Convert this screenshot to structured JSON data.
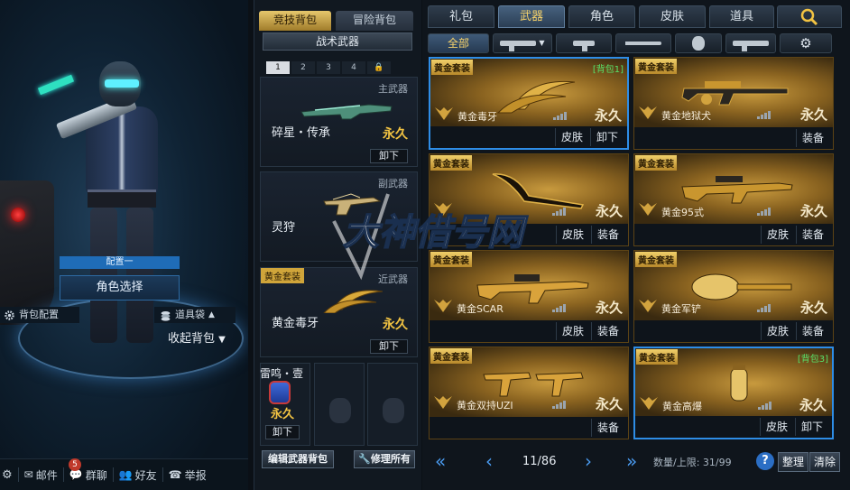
{
  "left": {
    "config_label": "配置一",
    "role_select": "角色选择",
    "bag_config": "背包配置",
    "item_bag": "道具袋",
    "fold_bag": "收起背包",
    "bottom": {
      "mail": "邮件",
      "mail_count": "5",
      "group_chat": "群聊",
      "friends": "好友",
      "report": "举报"
    }
  },
  "equip": {
    "tabs": [
      "竞技背包",
      "冒险背包"
    ],
    "tactical": "战术武器",
    "slots": [
      "1",
      "2",
      "3",
      "4"
    ],
    "primary": {
      "kind": "主武器",
      "name": "碎星・传承",
      "perm": "永久",
      "unload": "卸下"
    },
    "secondary": {
      "kind": "副武器",
      "name": "灵狩"
    },
    "melee": {
      "tag": "黄金套装",
      "kind": "近武器",
      "name": "黄金毒牙",
      "perm": "永久",
      "unload": "卸下"
    },
    "grenade": {
      "name": "雷鸣・壹",
      "perm": "永久",
      "unload": "卸下"
    },
    "edit_button": "编辑武器背包",
    "repair_button": "修理所有"
  },
  "inventory": {
    "categories": [
      "礼包",
      "武器",
      "角色",
      "皮肤",
      "道具"
    ],
    "active_category": "武器",
    "sub_all": "全部",
    "cards": [
      {
        "tag": "黄金套装",
        "bag": "[背包1]",
        "name": "黄金毒牙",
        "perm": "永久",
        "actions": [
          "皮肤",
          "卸下"
        ]
      },
      {
        "tag": "黄金套装",
        "bag": "",
        "name": "黄金地狱犬",
        "perm": "永久",
        "actions": [
          "装备"
        ]
      },
      {
        "tag": "黄金套装",
        "bag": "",
        "name": "",
        "perm": "永久",
        "actions": [
          "皮肤",
          "装备"
        ]
      },
      {
        "tag": "黄金套装",
        "bag": "",
        "name": "黄金95式",
        "perm": "永久",
        "actions": [
          "皮肤",
          "装备"
        ]
      },
      {
        "tag": "黄金套装",
        "bag": "",
        "name": "黄金SCAR",
        "perm": "永久",
        "actions": [
          "皮肤",
          "装备"
        ]
      },
      {
        "tag": "黄金套装",
        "bag": "",
        "name": "黄金军铲",
        "perm": "永久",
        "actions": [
          "皮肤",
          "装备"
        ]
      },
      {
        "tag": "黄金套装",
        "bag": "",
        "name": "黄金双持UZI",
        "perm": "永久",
        "actions": [
          "装备"
        ]
      },
      {
        "tag": "黄金套装",
        "bag": "[背包3]",
        "name": "黄金高爆",
        "perm": "永久",
        "actions": [
          "皮肤",
          "卸下"
        ]
      }
    ],
    "pager": {
      "page": "11/86",
      "capacity": "数量/上限: 31/99",
      "help": "?",
      "sort": "整理",
      "clear": "清除"
    }
  },
  "watermark": "大神借号网",
  "colors": {
    "gold": "#f2c342",
    "accent_blue": "#2e8de6",
    "bag_green": "#58e26a"
  }
}
